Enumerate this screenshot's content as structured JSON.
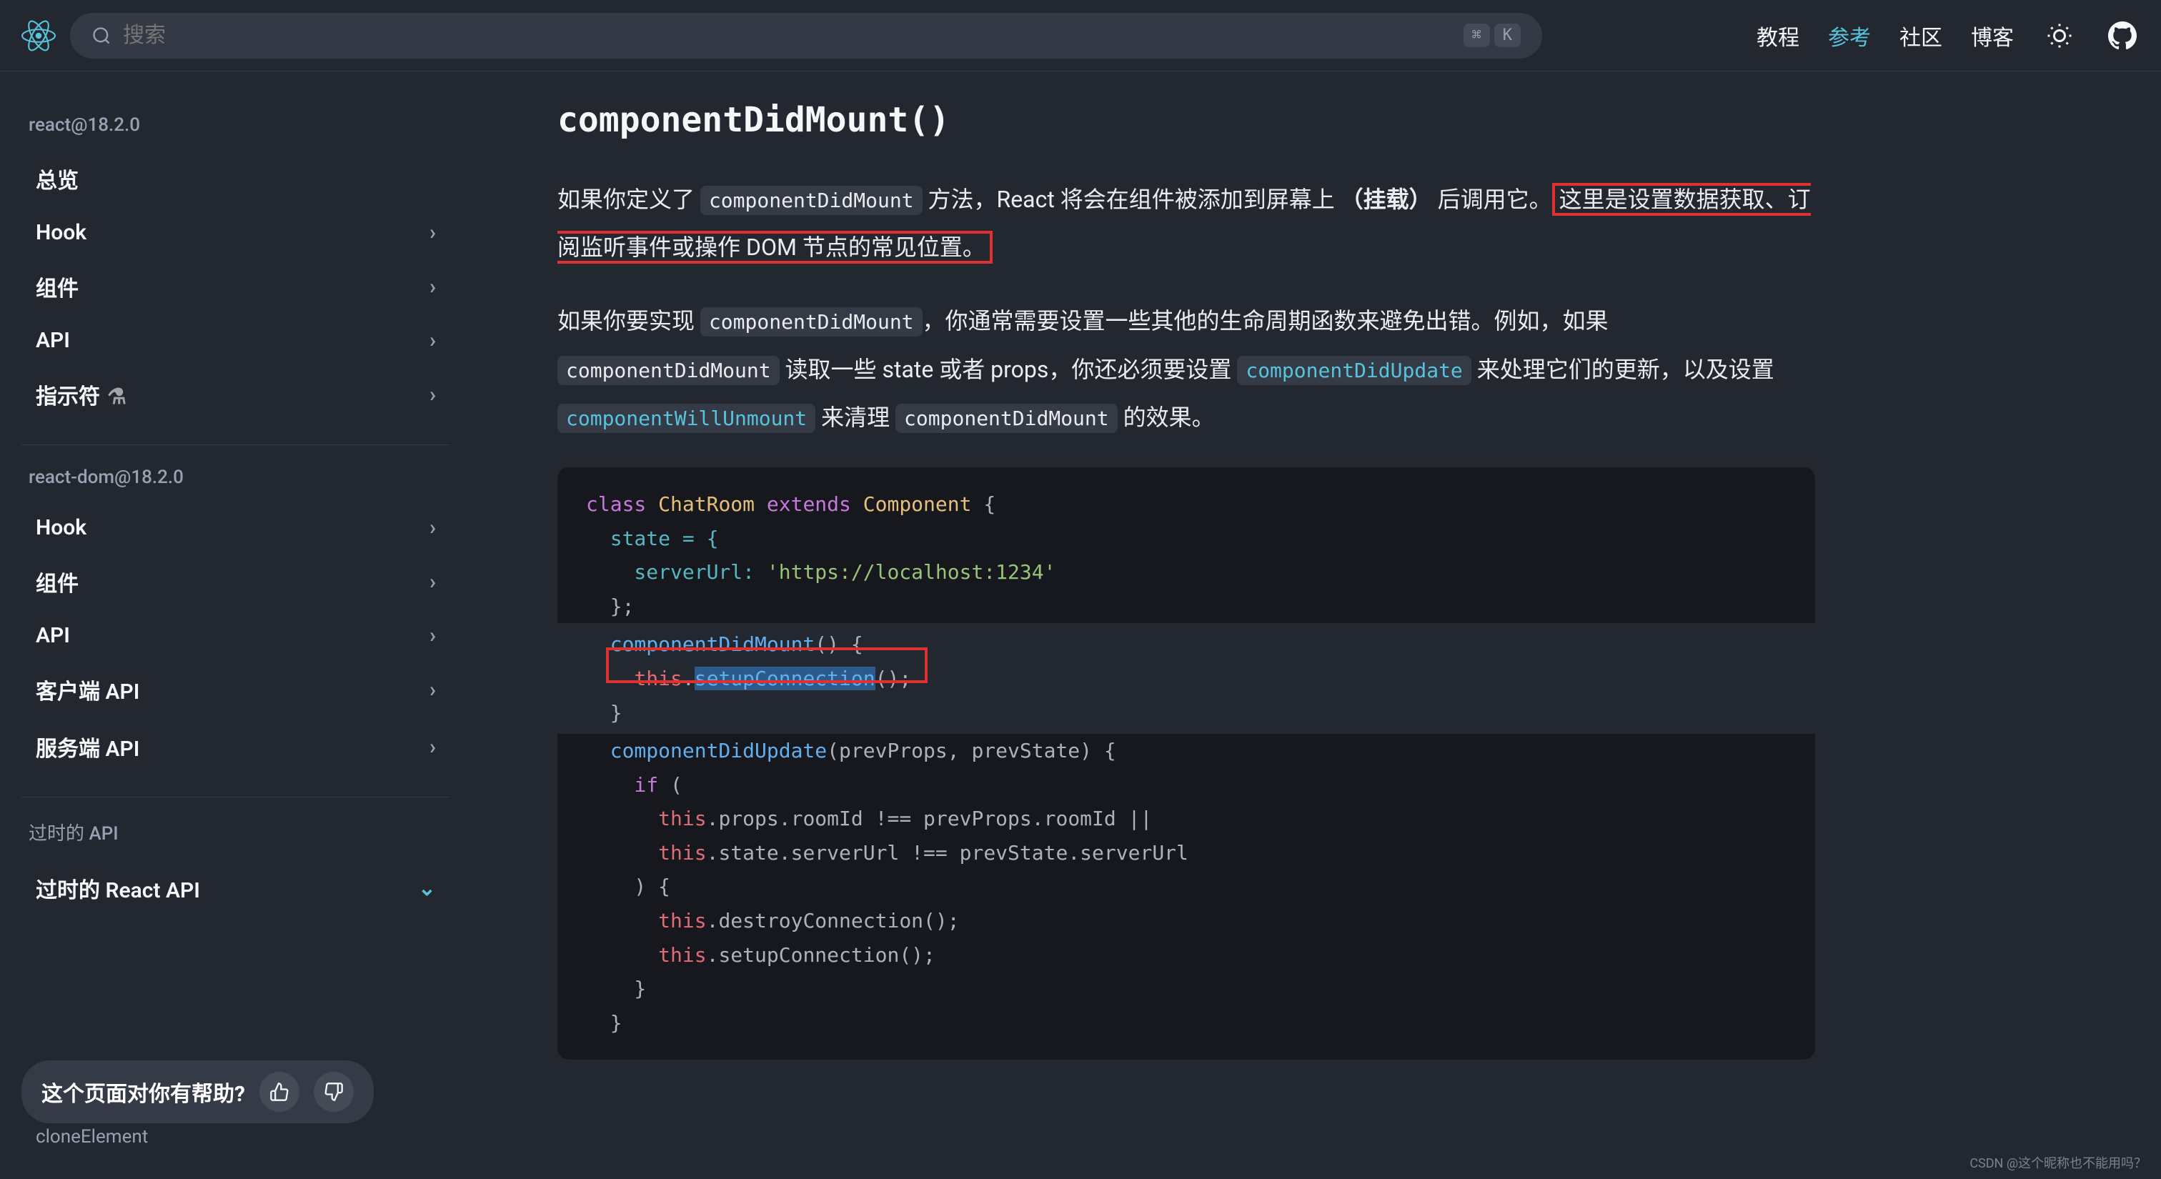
{
  "header": {
    "search_placeholder": "搜索",
    "kbd1": "⌘",
    "kbd2": "K",
    "links": [
      "教程",
      "参考",
      "社区",
      "博客"
    ],
    "active_index": 1
  },
  "sidebar": {
    "section1_label": "react@18.2.0",
    "section1_items": [
      "总览",
      "Hook",
      "组件",
      "API",
      "指示符"
    ],
    "section2_label": "react-dom@18.2.0",
    "section2_items": [
      "Hook",
      "组件",
      "API",
      "客户端 API",
      "服务端 API"
    ],
    "section3_label": "过时的 API",
    "section3_items": [
      "过时的 React API"
    ],
    "truncated_item": "cloneElement",
    "feedback_text": "这个页面对你有帮助?"
  },
  "content": {
    "title": "componentDidMount()",
    "para1_a": "如果你定义了 ",
    "para1_code1": "componentDidMount",
    "para1_b": " 方法，React 将会在组件被添加到屏幕上 ",
    "para1_bold": "（挂载）",
    "para1_c": " 后调用它。",
    "para1_hl": "这里是设置数据获取、订阅监听事件或操作 DOM 节点的常见位置。",
    "para2_a": "如果你要实现 ",
    "para2_code1": "componentDidMount",
    "para2_b": "，你通常需要设置一些其他的生命周期函数来避免出错。例如，如果 ",
    "para2_code2": "componentDidMount",
    "para2_c": " 读取一些 state 或者 props，你还必须要设置 ",
    "para2_code3_link": "componentDidUpdate",
    "para2_d": " 来处理它们的更新，以及设置 ",
    "para2_code4_link": "componentWillUnmount",
    "para2_e": " 来清理 ",
    "para2_code5": "componentDidMount",
    "para2_f": " 的效果。",
    "code": {
      "l1_kw": "class",
      "l1_cls": "ChatRoom",
      "l1_ext": "extends",
      "l1_comp": "Component",
      "l1_b": " {",
      "l2": "  state = {",
      "l3_a": "    serverUrl: ",
      "l3_str": "'https://localhost:1234'",
      "l4": "  };",
      "l6_fn": "  componentDidMount",
      "l6_b": "() {",
      "l7_a": "    ",
      "l7_this": "this",
      "l7_dot": ".",
      "l7_fn_sel": "setupConnection",
      "l7_b": "();",
      "l8": "  }",
      "l10_fn": "  componentDidUpdate",
      "l10_b": "(prevProps, prevState) {",
      "l11_if": "    if",
      "l11_b": " (",
      "l12_a": "      ",
      "l12_this": "this",
      "l12_b": ".props.roomId !== prevProps.roomId ||",
      "l13_a": "      ",
      "l13_this": "this",
      "l13_b": ".state.serverUrl !== prevState.serverUrl",
      "l14": "    ) {",
      "l15_a": "      ",
      "l15_this": "this",
      "l15_b": ".destroyConnection();",
      "l16_a": "      ",
      "l16_this": "this",
      "l16_b": ".setupConnection();",
      "l17": "    }",
      "l18": "  }"
    }
  },
  "watermark": "CSDN @这个昵称也不能用吗？"
}
